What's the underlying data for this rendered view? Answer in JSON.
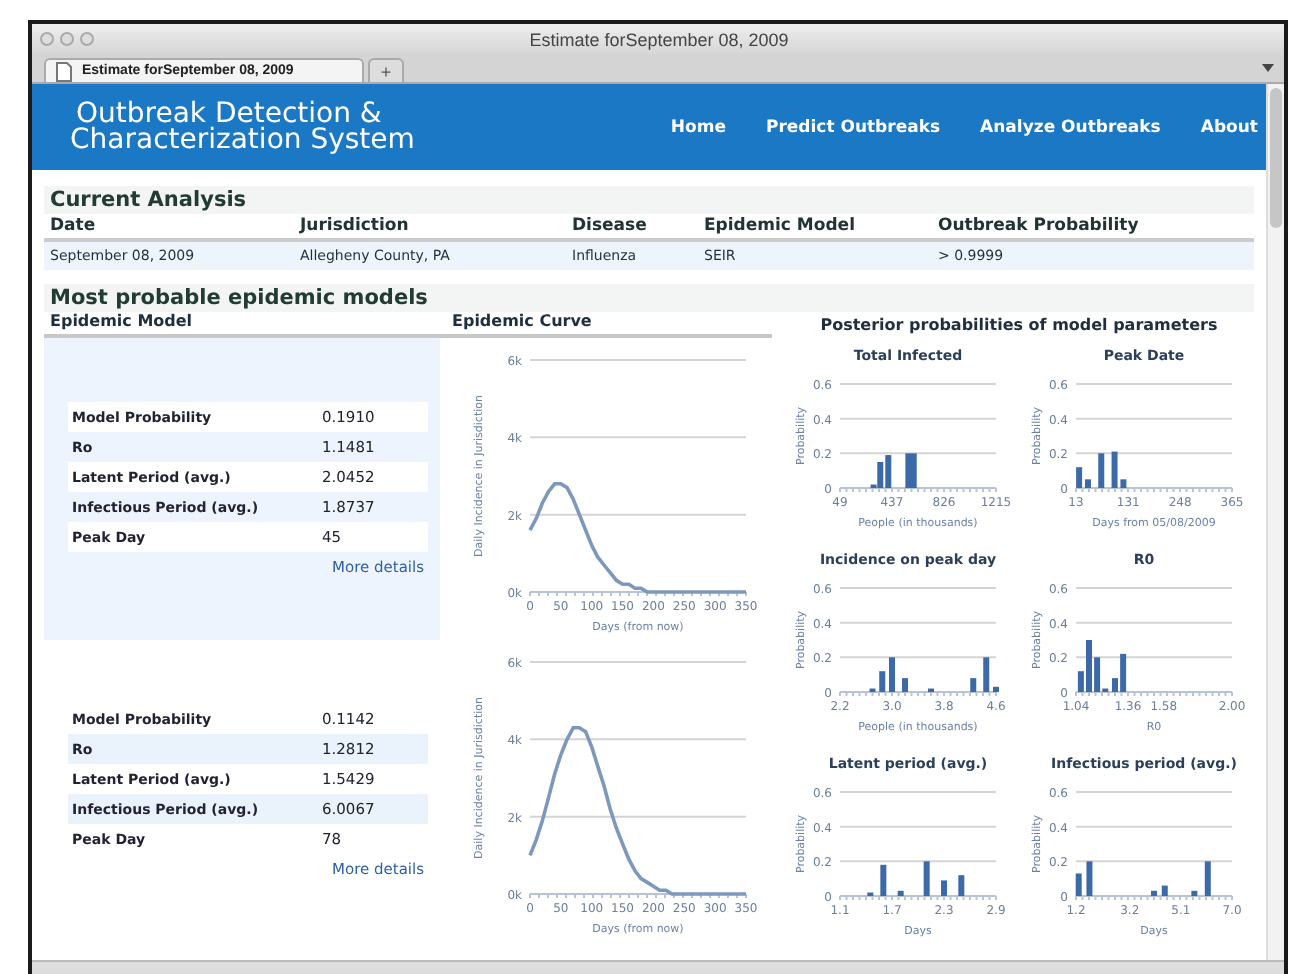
{
  "window": {
    "title": "Estimate forSeptember 08, 2009"
  },
  "tabs": [
    {
      "label": "Estimate forSeptember 08, 2009",
      "selected": true
    }
  ],
  "new_tab": "+",
  "header": {
    "logo_lines": [
      "Outbreak Detection &",
      "Characterization System"
    ],
    "nav": [
      "Home",
      "Predict Outbreaks",
      "Analyze Outbreaks",
      "About"
    ]
  },
  "current_analysis": {
    "title": "Current Analysis",
    "columns": [
      "Date",
      "Jurisdiction",
      "Disease",
      "Epidemic Model",
      "Outbreak Probability"
    ],
    "rows": [
      [
        "September 08, 2009",
        "Allegheny County, PA",
        "Influenza",
        "SEIR",
        "> 0.9999"
      ]
    ]
  },
  "models_section": {
    "title": "Most probable epidemic models",
    "columns": [
      "Epidemic Model",
      "Epidemic Curve"
    ],
    "posterior_title": "Posterior probabilities of model parameters",
    "models": [
      {
        "parameters": [
          {
            "label": "Model Probability",
            "value": "0.1910"
          },
          {
            "label": "Ro",
            "value": "1.1481"
          },
          {
            "label": "Latent Period (avg.)",
            "value": "2.0452"
          },
          {
            "label": "Infectious Period (avg.)",
            "value": "1.8737"
          },
          {
            "label": "Peak Day",
            "value": "45"
          }
        ],
        "link": "More details",
        "chart_data": {
          "type": "line",
          "xlabel": "Days (from now)",
          "ylabel": "Daily Incidence in Jurisdiction",
          "xlim": [
            0,
            350
          ],
          "ylim": [
            0,
            6000
          ],
          "xticks": [
            0,
            50,
            100,
            150,
            200,
            250,
            300,
            350
          ],
          "yticks": [
            {
              "value": 0,
              "label": "0k"
            },
            {
              "value": 2000,
              "label": "2k"
            },
            {
              "value": 4000,
              "label": "4k"
            },
            {
              "value": 6000,
              "label": "6k"
            }
          ],
          "x": [
            0,
            10,
            20,
            30,
            40,
            50,
            60,
            70,
            80,
            90,
            100,
            110,
            120,
            130,
            140,
            150,
            160,
            170,
            180,
            190,
            200,
            210,
            220,
            230,
            240,
            250,
            260,
            270,
            280,
            290,
            300,
            310,
            320,
            330,
            340,
            350
          ],
          "values": [
            1600,
            1900,
            2300,
            2600,
            2800,
            2800,
            2700,
            2400,
            2000,
            1600,
            1200,
            900,
            700,
            500,
            300,
            200,
            200,
            100,
            100,
            0,
            0,
            0,
            0,
            0,
            0,
            0,
            0,
            0,
            0,
            0,
            0,
            0,
            0,
            0,
            0,
            0
          ]
        }
      },
      {
        "parameters": [
          {
            "label": "Model Probability",
            "value": "0.1142"
          },
          {
            "label": "Ro",
            "value": "1.2812"
          },
          {
            "label": "Latent Period (avg.)",
            "value": "1.5429"
          },
          {
            "label": "Infectious Period (avg.)",
            "value": "6.0067"
          },
          {
            "label": "Peak Day",
            "value": "78"
          }
        ],
        "link": "More details",
        "chart_data": {
          "type": "line",
          "xlabel": "Days (from now)",
          "ylabel": "Daily Incidence in Jurisdiction",
          "xlim": [
            0,
            350
          ],
          "ylim": [
            0,
            6000
          ],
          "xticks": [
            0,
            50,
            100,
            150,
            200,
            250,
            300,
            350
          ],
          "yticks": [
            {
              "value": 0,
              "label": "0k"
            },
            {
              "value": 2000,
              "label": "2k"
            },
            {
              "value": 4000,
              "label": "4k"
            },
            {
              "value": 6000,
              "label": "6k"
            }
          ],
          "x": [
            0,
            10,
            20,
            30,
            40,
            50,
            60,
            70,
            80,
            90,
            100,
            110,
            120,
            130,
            140,
            150,
            160,
            170,
            180,
            190,
            200,
            210,
            220,
            230,
            240,
            250,
            260,
            270,
            280,
            290,
            300,
            310,
            320,
            330,
            340,
            350
          ],
          "values": [
            1000,
            1400,
            1900,
            2500,
            3100,
            3600,
            4000,
            4300,
            4300,
            4200,
            3800,
            3300,
            2800,
            2200,
            1700,
            1300,
            900,
            600,
            400,
            300,
            200,
            100,
            100,
            0,
            0,
            0,
            0,
            0,
            0,
            0,
            0,
            0,
            0,
            0,
            0,
            0
          ]
        }
      }
    ],
    "posteriors": [
      {
        "chart_data": {
          "type": "bar",
          "title": "Total Infected",
          "xlabel": "People (in thousands)",
          "ylabel": "Probability",
          "xlim": [
            49,
            1215
          ],
          "ylim": [
            0,
            0.6
          ],
          "xticks": [
            49,
            437,
            826,
            1215
          ],
          "yticks": [
            0,
            0.2,
            0.4,
            0.6
          ],
          "x": [
            300,
            350,
            410,
            560,
            600
          ],
          "values": [
            0.02,
            0.15,
            0.19,
            0.2,
            0.2
          ]
        }
      },
      {
        "chart_data": {
          "type": "bar",
          "title": "Peak Date",
          "xlabel": "Days from 05/08/2009",
          "ylabel": "Probability",
          "xlim": [
            13,
            365
          ],
          "ylim": [
            0,
            0.6
          ],
          "xticks": [
            13,
            131,
            248,
            365
          ],
          "yticks": [
            0,
            0.2,
            0.4,
            0.6
          ],
          "x": [
            20,
            40,
            70,
            100,
            120
          ],
          "values": [
            0.12,
            0.05,
            0.2,
            0.21,
            0.05
          ]
        }
      },
      {
        "chart_data": {
          "type": "bar",
          "title": "Incidence on peak day",
          "xlabel": "People (in thousands)",
          "ylabel": "Probability",
          "xlim": [
            2.2,
            4.6
          ],
          "ylim": [
            0,
            0.6
          ],
          "xticks": [
            2.2,
            {
              "value": 3,
              "label": "3.0"
            },
            3.8,
            4.6
          ],
          "yticks": [
            0,
            0.2,
            0.4,
            0.6
          ],
          "x": [
            2.7,
            2.85,
            3.0,
            3.2,
            3.6,
            4.25,
            4.45,
            4.6
          ],
          "values": [
            0.02,
            0.12,
            0.2,
            0.08,
            0.02,
            0.08,
            0.2,
            0.03
          ]
        }
      },
      {
        "chart_data": {
          "type": "bar",
          "title": "R0",
          "xlabel": "R0",
          "ylabel": "Probability",
          "xlim": [
            1.04,
            2
          ],
          "ylim": [
            0,
            0.6
          ],
          "xticks": [
            1.04,
            1.36,
            1.58,
            {
              "value": 2,
              "label": "2.00"
            }
          ],
          "yticks": [
            0,
            0.2,
            0.4,
            0.6
          ],
          "x": [
            1.07,
            1.12,
            1.17,
            1.22,
            1.28,
            1.33
          ],
          "values": [
            0.12,
            0.3,
            0.2,
            0.02,
            0.08,
            0.22
          ]
        }
      },
      {
        "chart_data": {
          "type": "bar",
          "title": "Latent period (avg.)",
          "xlabel": "Days",
          "ylabel": "Probability",
          "xlim": [
            1.1,
            2.9
          ],
          "ylim": [
            0,
            0.6
          ],
          "xticks": [
            1.1,
            1.7,
            2.3,
            2.9
          ],
          "yticks": [
            0,
            0.2,
            0.4,
            0.6
          ],
          "x": [
            1.45,
            1.6,
            1.8,
            2.1,
            2.3,
            2.5
          ],
          "values": [
            0.02,
            0.18,
            0.03,
            0.2,
            0.09,
            0.12
          ]
        }
      },
      {
        "chart_data": {
          "type": "bar",
          "title": "Infectious period (avg.)",
          "xlabel": "Days",
          "ylabel": "Probability",
          "xlim": [
            1.2,
            7
          ],
          "ylim": [
            0,
            0.6
          ],
          "xticks": [
            1.2,
            3.2,
            5.1,
            {
              "value": 7,
              "label": "7.0"
            }
          ],
          "yticks": [
            0,
            0.2,
            0.4,
            0.6
          ],
          "x": [
            1.3,
            1.7,
            4.1,
            4.5,
            5.6,
            6.1
          ],
          "values": [
            0.13,
            0.2,
            0.03,
            0.06,
            0.03,
            0.2
          ]
        }
      }
    ]
  }
}
